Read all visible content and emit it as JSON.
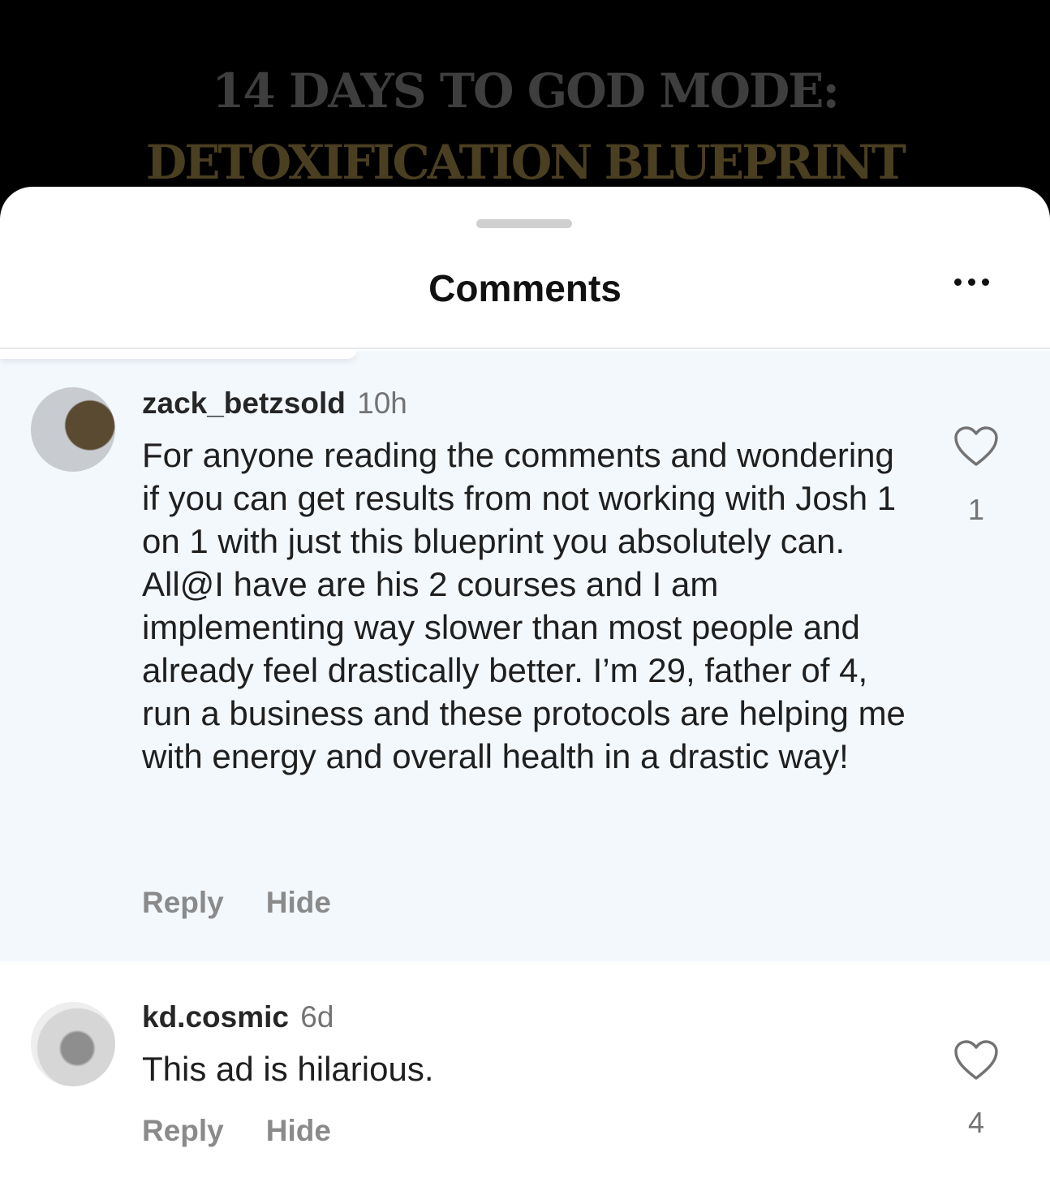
{
  "ad": {
    "line1": "14 DAYS TO GOD MODE:",
    "line2": "DETOXIFICATION BLUEPRINT"
  },
  "sheet": {
    "title": "Comments",
    "more_icon": "more-horizontal-icon"
  },
  "comments": [
    {
      "username": "zack_betzsold",
      "time": "10h",
      "text": "For anyone reading the comments and wondering if you can get results from not working with Josh 1 on 1 with just this blueprint you absolutely can. All@I have are his 2 courses and I am implementing way slower than most people and already feel drastically better. I’m 29, father of 4, run a business and these protocols are helping me with energy and overall health in a drastic way!",
      "reply_label": "Reply",
      "hide_label": "Hide",
      "likes": "1",
      "highlighted": true
    },
    {
      "username": "kd.cosmic",
      "time": "6d",
      "text": "This ad is hilarious.",
      "reply_label": "Reply",
      "hide_label": "Hide",
      "likes": "4",
      "highlighted": false
    }
  ],
  "colors": {
    "highlight_bg": "#f3f8fd",
    "ad_gold": "#4b3f21",
    "ad_gray": "#3e3e3e"
  }
}
